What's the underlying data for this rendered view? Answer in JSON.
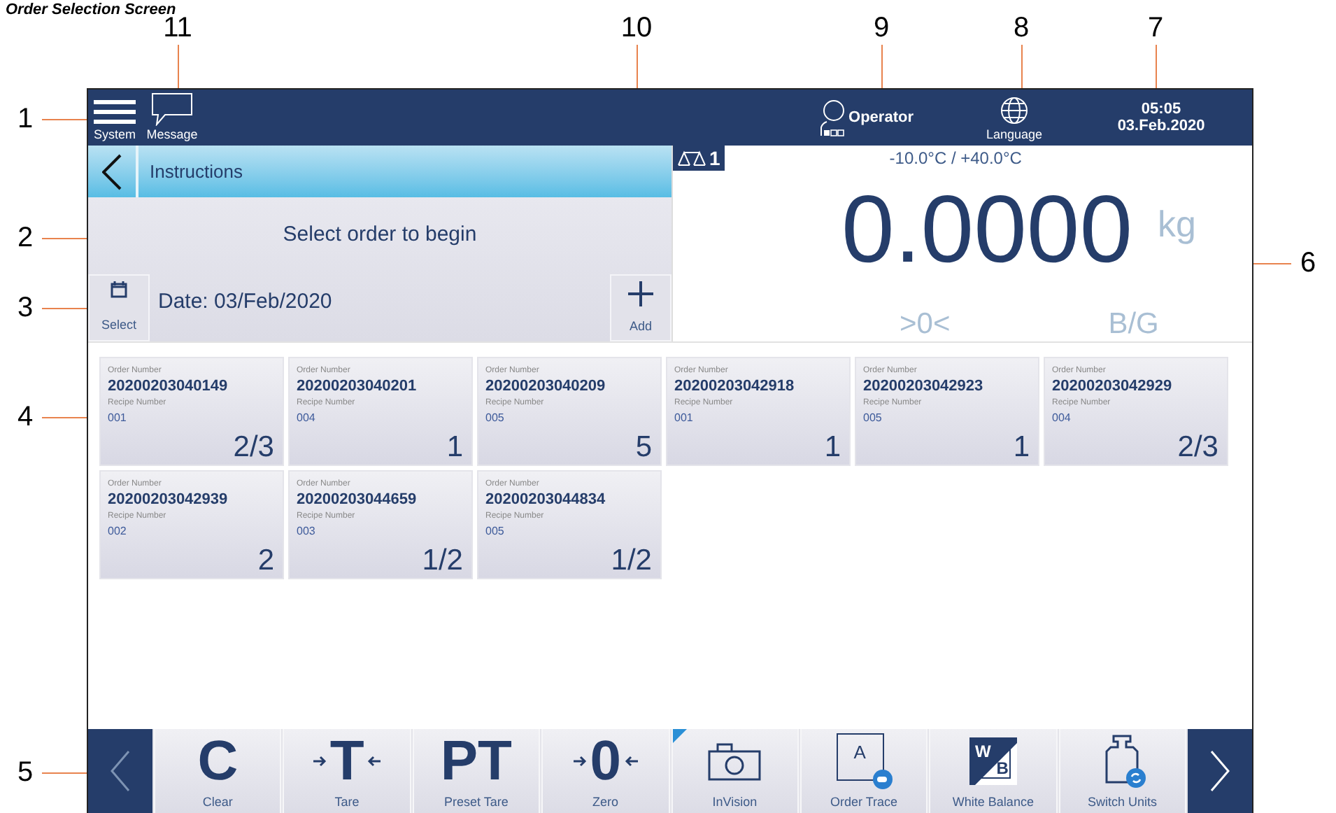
{
  "title": "Order Selection Screen",
  "callouts": [
    {
      "label": "11"
    },
    {
      "label": "10"
    },
    {
      "label": "9"
    },
    {
      "label": "8"
    },
    {
      "label": "7"
    },
    {
      "label": "1"
    },
    {
      "label": "2"
    },
    {
      "label": "6"
    },
    {
      "label": "3"
    },
    {
      "label": "4"
    },
    {
      "label": "5"
    }
  ],
  "top_bar": {
    "system_label": "System",
    "message_label": "Message",
    "user": "Operator",
    "language_label": "Language",
    "time": "05:05",
    "date": "03.Feb.2020"
  },
  "instructions": {
    "title": "Instructions",
    "message": "Select order to begin",
    "date": "Date: 03/Feb/2020",
    "select_label": "Select",
    "add_label": "Add"
  },
  "scale": {
    "number": "1",
    "range": "-10.0°C / +40.0°C",
    "weight": "0.0000",
    "unit": "kg",
    "zero": ">0<",
    "mode": "B/G"
  },
  "orders": [
    {
      "order_label": "Order Number",
      "order_number": "20200203040149",
      "recipe_label": "Recipe Number",
      "recipe_number": "001",
      "count": "2/3"
    },
    {
      "order_label": "Order Number",
      "order_number": "20200203040201",
      "recipe_label": "Recipe Number",
      "recipe_number": "004",
      "count": "1"
    },
    {
      "order_label": "Order Number",
      "order_number": "20200203040209",
      "recipe_label": "Recipe Number",
      "recipe_number": "005",
      "count": "5"
    },
    {
      "order_label": "Order Number",
      "order_number": "20200203042918",
      "recipe_label": "Recipe Number",
      "recipe_number": "001",
      "count": "1"
    },
    {
      "order_label": "Order Number",
      "order_number": "20200203042923",
      "recipe_label": "Recipe Number",
      "recipe_number": "005",
      "count": "1"
    },
    {
      "order_label": "Order Number",
      "order_number": "20200203042929",
      "recipe_label": "Recipe Number",
      "recipe_number": "004",
      "count": "2/3"
    },
    {
      "order_label": "Order Number",
      "order_number": "20200203042939",
      "recipe_label": "Recipe Number",
      "recipe_number": "002",
      "count": "2"
    },
    {
      "order_label": "Order Number",
      "order_number": "20200203044659",
      "recipe_label": "Recipe Number",
      "recipe_number": "003",
      "count": "1/2"
    },
    {
      "order_label": "Order Number",
      "order_number": "20200203044834",
      "recipe_label": "Recipe Number",
      "recipe_number": "005",
      "count": "1/2"
    }
  ],
  "softkeys": [
    {
      "kind": "text",
      "glyph": "C",
      "label": "Clear",
      "flagged": false
    },
    {
      "kind": "arrows",
      "glyph": "T",
      "label": "Tare",
      "flagged": false
    },
    {
      "kind": "text",
      "glyph": "PT",
      "label": "Preset Tare",
      "flagged": false
    },
    {
      "kind": "arrows",
      "glyph": "0",
      "label": "Zero",
      "flagged": false
    },
    {
      "kind": "camera",
      "label": "InVision",
      "flagged": true
    },
    {
      "kind": "trace",
      "glyph": "A",
      "label": "Order Trace",
      "flagged": false
    },
    {
      "kind": "balance",
      "glyph": "W",
      "glyph2": "B",
      "label": "White Balance",
      "flagged": false
    },
    {
      "kind": "weight",
      "label": "Switch Units",
      "flagged": false
    }
  ]
}
